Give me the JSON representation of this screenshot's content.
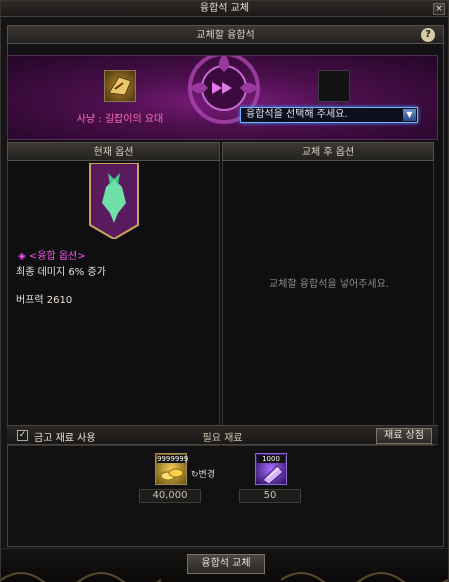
{
  "window": {
    "title": "융합석 교체",
    "close_glyph": "×"
  },
  "top_section": {
    "header": "교체할 융합석",
    "help_glyph": "?",
    "current_stone_name": "사냥 : 길잡이의 요대",
    "dropdown": {
      "selected_text": "융합석을 선택해 주세요.",
      "arrow_glyph": "▼"
    }
  },
  "current_options": {
    "header": "현재 옵션",
    "option_title": "◈ <융합 옵션>",
    "option_lines": [
      "최종 데미지 6% 증가",
      "버프력 2610"
    ]
  },
  "after_options": {
    "header": "교체 후 옵션",
    "empty_message": "교체할 융합석을 넣어주세요."
  },
  "materials": {
    "use_safe_label": "금고 재료 사용",
    "checked": true,
    "check_glyph": "✓",
    "needed_label": "필요 재료",
    "shop_button": "재료 상점",
    "gold": {
      "badge": "9999999",
      "change_label": "↻변경",
      "count": "40,000"
    },
    "cube": {
      "badge": "1000",
      "count": "50"
    }
  },
  "actions": {
    "exchange_button": "융합석 교체"
  },
  "colors": {
    "accent_purple": "#7b1c7c",
    "name_pink": "#ff6eb0",
    "option_magenta": "#ff4ff0",
    "dropdown_blue": "#6fb4ff"
  },
  "icons": [
    "help-icon",
    "close-icon",
    "belt-item-icon",
    "wolf-emblem-icon",
    "gold-icon",
    "cube-icon",
    "dropdown-arrow-icon"
  ]
}
